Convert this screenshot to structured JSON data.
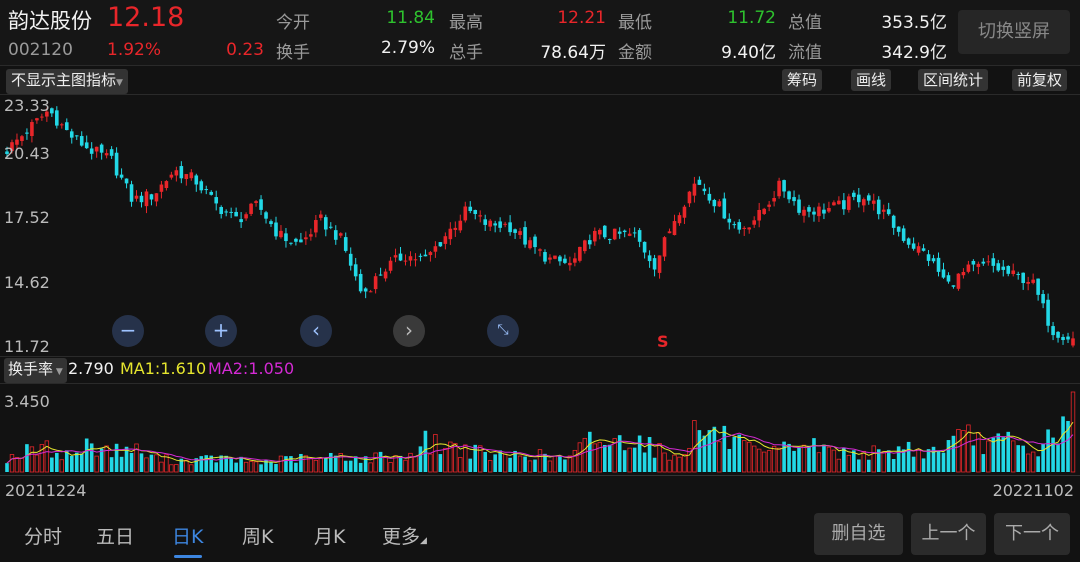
{
  "header": {
    "name": "韵达股份",
    "price": "12.18",
    "code": "002120",
    "pct": "1.92%",
    "change": "0.23",
    "fields": [
      {
        "label": "今开",
        "value": "11.84"
      },
      {
        "label": "最高",
        "value": "12.21"
      },
      {
        "label": "最低",
        "value": "11.72"
      },
      {
        "label": "总值",
        "value": "353.5亿"
      },
      {
        "label": "换手",
        "value": "2.79%"
      },
      {
        "label": "总手",
        "value": "78.64万"
      },
      {
        "label": "金额",
        "value": "9.40亿"
      },
      {
        "label": "流值",
        "value": "342.9亿"
      }
    ],
    "switch_label": "切换竖屏"
  },
  "toolbar": {
    "indicator": "不显示主图指标",
    "chips": [
      "筹码",
      "画线",
      "区间统计",
      "前复权"
    ]
  },
  "colors": {
    "up": "#e8262a",
    "down": "#22d8e6",
    "ma1": "#e6e62e",
    "ma2": "#d42ad4"
  },
  "chart_data": {
    "type": "candlestick",
    "yticks": [
      "23.33",
      "20.43",
      "17.52",
      "14.62",
      "11.72"
    ],
    "ylim": [
      11.72,
      23.33
    ],
    "anchor_closes": [
      21.18,
      22.14,
      23.09,
      21.9,
      21.18,
      20.7,
      18.79,
      19.03,
      20.22,
      19.75,
      18.55,
      17.84,
      18.55,
      17.12,
      16.64,
      17.84,
      16.88,
      14.25,
      15.45,
      16.16,
      15.92,
      17.12,
      18.31,
      17.6,
      17.6,
      16.64,
      15.92,
      15.69,
      17.12,
      17.12,
      17.12,
      15.69,
      18.07,
      19.75,
      18.55,
      17.36,
      18.07,
      19.51,
      18.31,
      18.31,
      18.55,
      19.03,
      18.07,
      16.88,
      16.16,
      14.73,
      15.45,
      15.69,
      15.21,
      14.97,
      12.58,
      12.18
    ],
    "candle_count": 215,
    "marker": "S",
    "start_date": "20211224",
    "end_date": "20221102"
  },
  "volume": {
    "selector": "换手率",
    "value": "2.790",
    "ma1": "MA1:1.610",
    "ma2": "MA2:1.050",
    "ymax_label": "3.450",
    "ymax": 3.45,
    "anchor_turnover": [
      0.6,
      0.9,
      1.0,
      0.7,
      1.2,
      0.9,
      1.0,
      0.6,
      0.5,
      0.5,
      0.6,
      0.5,
      0.4,
      0.5,
      0.6,
      0.5,
      0.8,
      0.5,
      0.7,
      0.6,
      1.3,
      1.1,
      1.0,
      0.7,
      0.7,
      0.8,
      0.6,
      0.6,
      1.5,
      1.2,
      1.6,
      1.0,
      0.6,
      1.9,
      1.6,
      1.2,
      0.7,
      0.9,
      1.3,
      1.0,
      0.8,
      0.9,
      0.7,
      1.1,
      0.8,
      1.2,
      1.5,
      1.2,
      1.3,
      0.7,
      1.6,
      2.79
    ]
  },
  "nav": {
    "tabs": [
      "分时",
      "五日",
      "日K",
      "周K",
      "月K",
      "更多"
    ],
    "active": 2,
    "buttons": [
      "删自选",
      "上一个",
      "下一个"
    ]
  }
}
